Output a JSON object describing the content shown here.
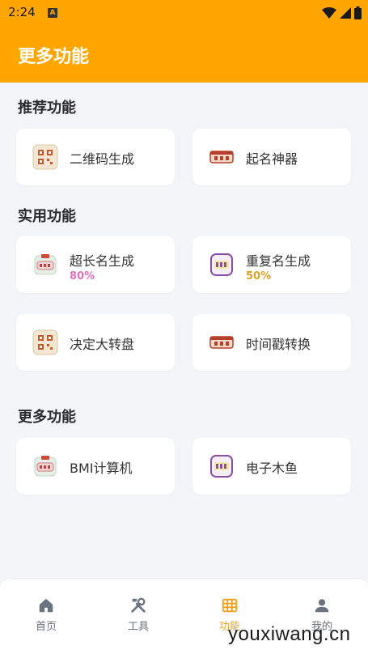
{
  "status_bar": {
    "time": "2:24",
    "notification_icon_letter": "A"
  },
  "app_bar": {
    "title": "更多功能"
  },
  "sections": [
    {
      "title": "推荐功能",
      "items": [
        {
          "label": "二维码生成",
          "icon": "qr-app-icon"
        },
        {
          "label": "起名神器",
          "icon": "tag-app-icon"
        }
      ]
    },
    {
      "title": "实用功能",
      "items": [
        {
          "label": "超长名生成",
          "badge": "80%",
          "badge_color": "#e070b8",
          "icon": "green-card-icon"
        },
        {
          "label": "重复名生成",
          "badge": "50%",
          "badge_color": "#e0a020",
          "icon": "purple-card-icon"
        },
        {
          "label": "决定大转盘",
          "icon": "qr-app-icon"
        },
        {
          "label": "时间戳转换",
          "icon": "tag-app-icon"
        }
      ]
    },
    {
      "title": "更多功能",
      "items": [
        {
          "label": "BMI计算机",
          "icon": "green-card-icon"
        },
        {
          "label": "电子木鱼",
          "icon": "purple-card-icon"
        }
      ]
    }
  ],
  "bottom_nav": [
    {
      "label": "首页",
      "icon": "home-icon",
      "active": false
    },
    {
      "label": "工具",
      "icon": "tools-icon",
      "active": false
    },
    {
      "label": "功能",
      "icon": "grid-icon",
      "active": true
    },
    {
      "label": "我的",
      "icon": "person-icon",
      "active": false
    }
  ],
  "watermark": "youxiwang.cn",
  "colors": {
    "accent": "#ffa600",
    "active_nav": "#f0a020",
    "inactive_nav": "#6a7380"
  }
}
